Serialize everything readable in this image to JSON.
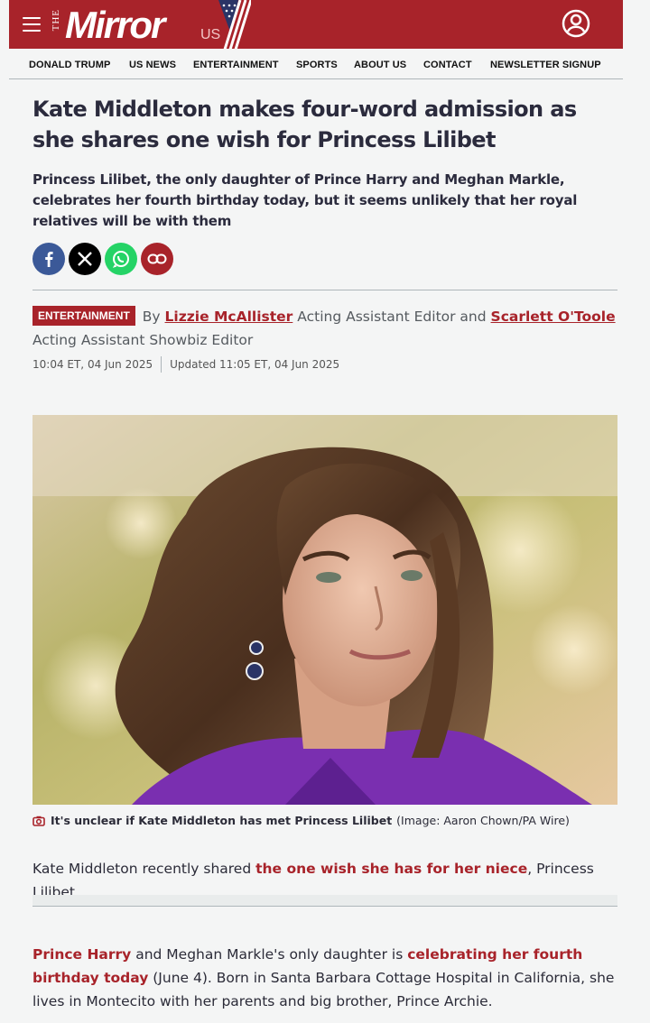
{
  "header": {
    "logo_the": "THE",
    "logo_mirror": "Mirror",
    "logo_us": "US"
  },
  "nav": {
    "items": [
      "DONALD TRUMP",
      "US NEWS",
      "ENTERTAINMENT",
      "SPORTS",
      "ABOUT US",
      "CONTACT",
      "NEWSLETTER SIGNUP"
    ]
  },
  "article": {
    "headline": "Kate Middleton makes four-word admission as she shares one wish for Princess Lilibet",
    "standfirst": "Princess Lilibet, the only daughter of Prince Harry and Meghan Markle, celebrates her fourth birthday today, but it seems unlikely that her royal relatives will be with them",
    "category": "ENTERTAINMENT",
    "by": "By",
    "author1": "Lizzie McAllister",
    "author1_role": "Acting Assistant Editor and",
    "author2": "Scarlett O'Toole",
    "author2_role": "Acting Assistant Showbiz Editor",
    "published": "10:04 ET, 04 Jun 2025",
    "updated": "Updated 11:05 ET, 04 Jun 2025",
    "caption": "It's unclear if Kate Middleton has met Princess Lilibet",
    "credit": "(Image: Aaron Chown/PA Wire)",
    "p1_a": "Kate Middleton recently shared ",
    "p1_link": "the one wish she has for her niece",
    "p1_b": ", Princess Lilibet.",
    "p2_link1": "Prince Harry",
    "p2_a": " and Meghan Markle's only daughter is ",
    "p2_link2": "celebrating her fourth birthday today",
    "p2_b": " (June 4). Born in Santa Barbara Cottage Hospital in California, she lives in Montecito with her parents and big brother, Prince Archie."
  },
  "colors": {
    "brand_red": "#a8232a",
    "facebook": "#3b5998",
    "x": "#000000",
    "whatsapp": "#25d366",
    "copy_link": "#a8232a"
  },
  "icons": [
    "menu-icon",
    "account-icon",
    "facebook-icon",
    "x-icon",
    "whatsapp-icon",
    "link-icon",
    "camera-icon"
  ]
}
